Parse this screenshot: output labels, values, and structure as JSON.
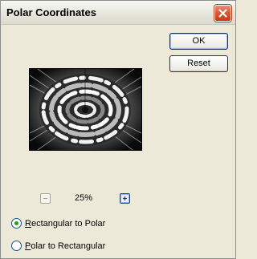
{
  "window": {
    "title": "Polar Coordinates"
  },
  "buttons": {
    "ok": "OK",
    "reset": "Reset"
  },
  "zoom": {
    "value": "25%"
  },
  "options": {
    "rect_to_polar": "Rectangular to Polar",
    "polar_to_rect": "Polar to Rectangular",
    "selected": "rect_to_polar"
  },
  "colors": {
    "close_button": "#d5532f",
    "radio_dot": "#21a121",
    "button_border": "#003c74"
  },
  "icons": {
    "close": "close-icon",
    "zoom_out": "minus-icon",
    "zoom_in": "plus-icon"
  }
}
